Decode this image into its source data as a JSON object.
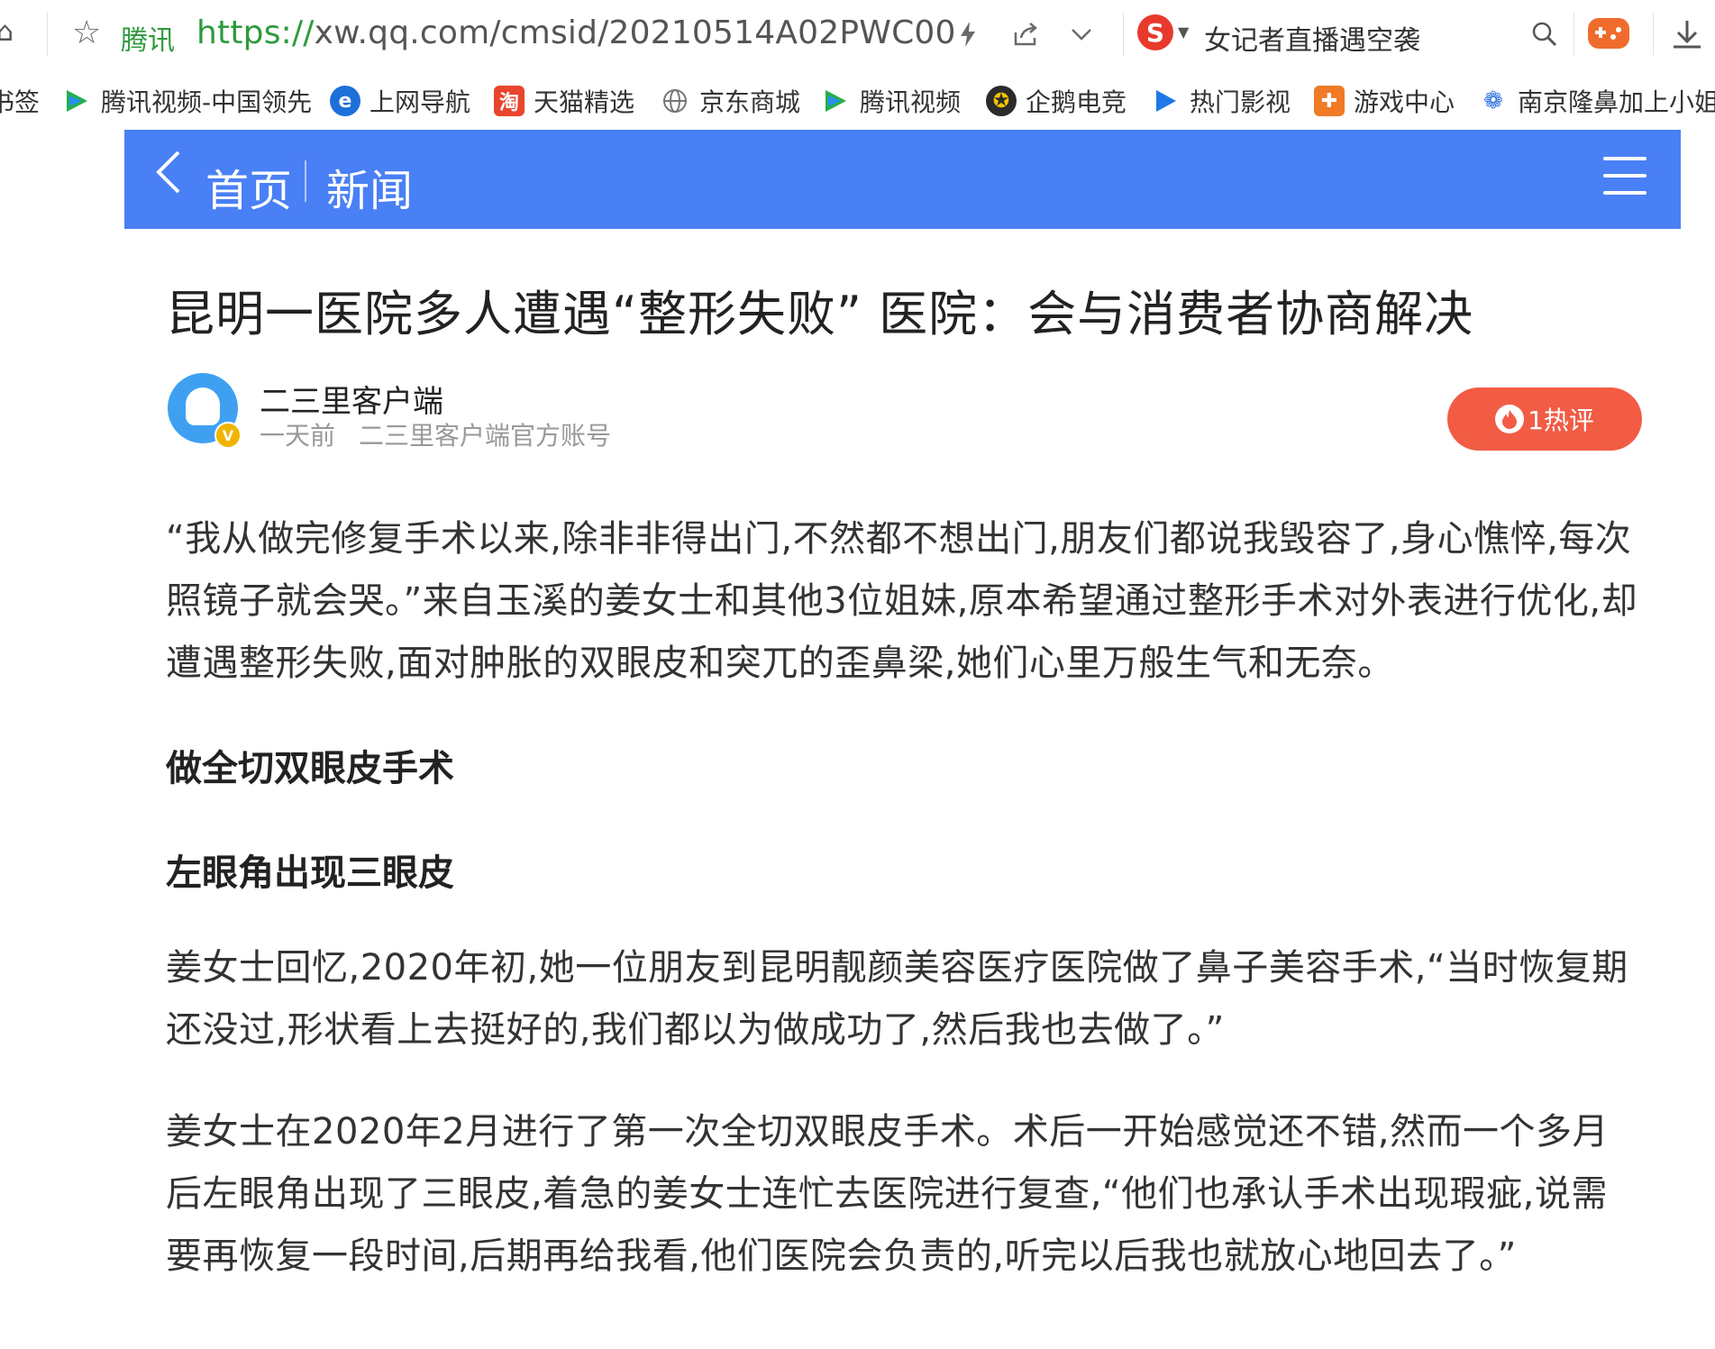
{
  "browser": {
    "site_name": "腾讯",
    "url_proto": "https://",
    "url_rest": "xw.qq.com/cmsid/20210514A02PWC00",
    "search_engine_letter": "S",
    "search_text": "女记者直播遇空袭",
    "accent": "#2f9a3c"
  },
  "bookmarks": [
    {
      "icon": "bookmark-icon",
      "label": "书签"
    },
    {
      "icon": "tencent-video-icon",
      "label": "腾讯视频-中国领先"
    },
    {
      "icon": "ie-icon",
      "label": "上网导航"
    },
    {
      "icon": "tmall-icon",
      "label": "天猫精选"
    },
    {
      "icon": "globe-icon",
      "label": "京东商城"
    },
    {
      "icon": "tencent-video-icon",
      "label": "腾讯视频"
    },
    {
      "icon": "penguin-esports-icon",
      "label": "企鹅电竞"
    },
    {
      "icon": "play-icon",
      "label": "热门影视"
    },
    {
      "icon": "game-icon",
      "label": "游戏中心"
    },
    {
      "icon": "baidu-paw-icon",
      "label": "南京隆鼻加上小姐"
    }
  ],
  "header": {
    "back_glyph": "<",
    "home_label": "首页",
    "section_label": "新闻",
    "color": "#4a80f5"
  },
  "article": {
    "title": "昆明一医院多人遭遇“整形失败” 医院：会与消费者协商解决",
    "author": {
      "name": "二三里客户端",
      "time": "一天前",
      "account": "二三里客户端官方账号",
      "verified_badge": "V"
    },
    "hot_comments_label": "1热评",
    "paragraphs": [
      "“我从做完修复手术以来,除非非得出门,不然都不想出门,朋友们都说我毁容了,身心憔悴,每次照镜子就会哭。”来自玉溪的姜女士和其他3位姐妹,原本希望通过整形手术对外表进行优化,却遭遇整形失败,面对肿胀的双眼皮和突兀的歪鼻梁,她们心里万般生气和无奈。",
      "姜女士回忆,2020年初,她一位朋友到昆明靓颜美容医疗医院做了鼻子美容手术,“当时恢复期还没过,形状看上去挺好的,我们都以为做成功了,然后我也去做了。”",
      "姜女士在2020年2月进行了第一次全切双眼皮手术。术后一开始感觉还不错,然而一个多月后左眼角出现了三眼皮,着急的姜女士连忙去医院进行复查,“他们也承认手术出现瑕疵,说需要再恢复一段时间,后期再给我看,他们医院会负责的,听完以后我也就放心地回去了。”"
    ],
    "subheadings": [
      "做全切双眼皮手术",
      "左眼角出现三眼皮"
    ]
  }
}
